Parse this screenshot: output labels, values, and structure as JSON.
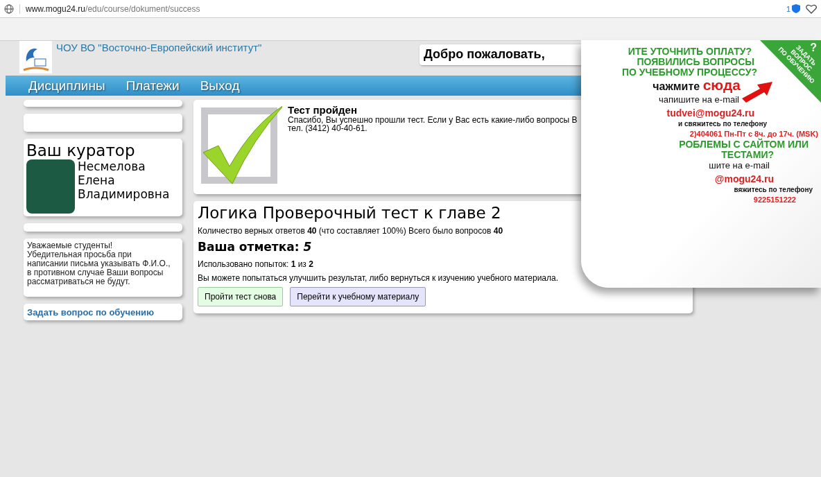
{
  "browser": {
    "url_host": "www.mogu24.ru",
    "url_path": "/edu/course/dokument/success",
    "badge": "1"
  },
  "header": {
    "institute": "ЧОУ ВО \"Восточно-Европейский институт\"",
    "welcome": "Добро пожаловать,"
  },
  "nav": [
    {
      "label": "Дисциплины"
    },
    {
      "label": "Платежи"
    },
    {
      "label": "Выход"
    }
  ],
  "sidebar": {
    "curator_title": "Ваш куратор",
    "curator_name": [
      "Несмелова",
      "Елена",
      "Владимировна"
    ],
    "notice": "Уважаемые студенты!\nУбедительная просьба при\nнаписании письма указывать Ф.И.О.,\nв противном случае Ваши вопросы\nрассматриваться не будут.",
    "ask_link": "Задать вопрос по обучению"
  },
  "success": {
    "title": "Тест пройден",
    "message": "Спасибо, Вы успешно прошли тест. Если у Вас есть какие-либо вопросы В",
    "phone": "тел. (3412) 40-40-61."
  },
  "result": {
    "title": "Логика Проверочный тест к главе 2",
    "correct": "Количество верных ответов **40** (что составляет 100%) Всего было вопросов **40**",
    "grade_label": "Ваша отметка:",
    "grade": "5",
    "attempts": "Использовано попыток: **1** из **2**",
    "hint": "Вы можете попытаться улучшить результат, либо вернуться к изучению учебного материала.",
    "buttons": [
      {
        "label": "Пройти тест снова",
        "kind": "retry"
      },
      {
        "label": "Перейти к учебному материалу",
        "kind": "material"
      }
    ]
  },
  "promo": {
    "ribbon": {
      "mark": "?",
      "lines": [
        "ЗАДАТЬ",
        "ВОПРОС",
        "ПО ОБУЧЕНИЮ"
      ]
    },
    "lines": [
      {
        "kind": "heading",
        "text": "ИТЕ УТОЧНИТЬ ОПЛАТУ?"
      },
      {
        "kind": "heading",
        "text": "ПОЯВИЛИСЬ ВОПРОСЫ"
      },
      {
        "kind": "heading",
        "text": "ПО УЧЕБНОМУ ПРОЦЕССУ?"
      },
      {
        "kind": "action",
        "text": "чажмите",
        "link": "сюда"
      },
      {
        "kind": "plain",
        "text": "чапишите на e-mail"
      },
      {
        "kind": "email",
        "text": "tudvei@mogu24.ru"
      },
      {
        "kind": "small",
        "text": "и свяжитесь по телефону"
      },
      {
        "kind": "phone",
        "text": "2)404061 Пн-Пт с 8ч. до 17ч. (MSK)"
      },
      {
        "kind": "heading",
        "text": "РОБЛЕМЫ С САЙТОМ ИЛИ"
      },
      {
        "kind": "heading",
        "text": "ТЕСТАМИ?"
      },
      {
        "kind": "plain",
        "text": "шите на e-mail"
      },
      {
        "kind": "email",
        "text": "@mogu24.ru"
      },
      {
        "kind": "small",
        "text": "вяжитесь по телефону"
      },
      {
        "kind": "phone",
        "text": "9225151222"
      }
    ]
  }
}
